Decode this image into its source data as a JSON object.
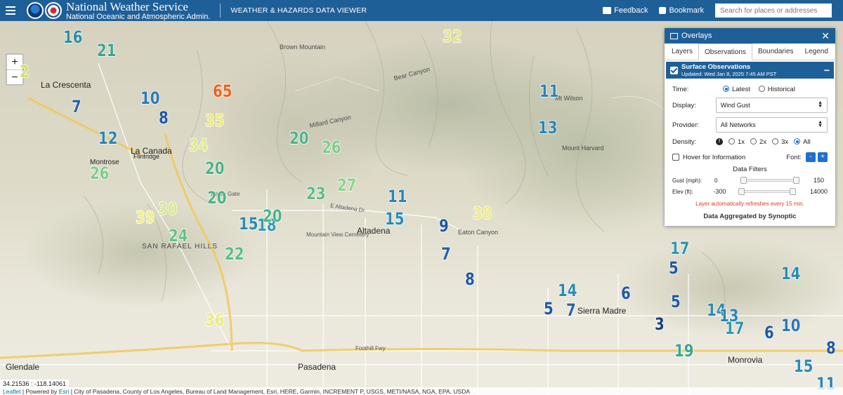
{
  "header": {
    "agency_name": "National Weather Service",
    "agency_sub": "National Oceanic and Atmospheric Admin.",
    "app_title": "WEATHER & HAZARDS DATA VIEWER",
    "feedback": "Feedback",
    "bookmark": "Bookmark",
    "search_placeholder": "Search for places or addresses"
  },
  "zoom": {
    "in": "+",
    "out": "−"
  },
  "panel": {
    "title": "Overlays",
    "close": "✕",
    "tabs": [
      "Layers",
      "Observations",
      "Boundaries",
      "Legend"
    ],
    "active_tab": "Observations",
    "section_title": "Surface Observations",
    "section_updated": "Updated: Wed Jan 8, 2025 7:45 AM PST",
    "collapse": "−",
    "time_label": "Time:",
    "time_options": [
      "Latest",
      "Historical"
    ],
    "time_selected": "Latest",
    "display_label": "Display:",
    "display_value": "Wind Gust",
    "provider_label": "Provider:",
    "provider_value": "All Networks",
    "density_label": "Density:",
    "density_options": [
      "1x",
      "2x",
      "3x",
      "All"
    ],
    "density_selected": "All",
    "hover_label": "Hover for Information",
    "font_label": "Font:",
    "font_minus": "-",
    "font_plus": "+",
    "filters_title": "Data Filters",
    "gust_label": "Gust (mph):",
    "gust_min": "0",
    "gust_max": "150",
    "elev_label": "Elev (ft):",
    "elev_min": "-300",
    "elev_max": "14000",
    "refresh_note": "Layer automatically refreshes every 15 min.",
    "aggregated": "Data Aggregated by Synoptic"
  },
  "map_labels": {
    "la_crescenta": "La Crescenta",
    "la_canada": "La Canada",
    "flintridge": "Flintridge",
    "montrose": "Montrose",
    "altadena": "Altadena",
    "pasadena": "Pasadena",
    "sierra_madre": "Sierra Madre",
    "monrovia": "Monrovia",
    "glendale": "Glendale",
    "mt_wilson": "Mt Wilson",
    "mount_harvard": "Mount Harvard",
    "san_rafael_hills": "SAN RAFAEL HILLS",
    "brown_mountain": "Brown Mountain",
    "bear_canyon": "Bear Canyon",
    "eaton_canyon": "Eaton Canyon",
    "millard_canyon": "Millard Canyon",
    "foothill_fwy": "Foothill Fwy",
    "e_altadena_dr": "E Altadena Dr",
    "mountain_view_cemetery": "Mountain View Cemetery",
    "devils_gate": "Devils Gate"
  },
  "observations": [
    {
      "value": "16",
      "color": "#2b8fa3"
    },
    {
      "value": "21",
      "color": "#3da58f"
    },
    {
      "value": "2",
      "color": "#d0e26c"
    },
    {
      "value": "10",
      "color": "#2a78b5"
    },
    {
      "value": "7",
      "color": "#2563a8"
    },
    {
      "value": "8",
      "color": "#1f5aa3"
    },
    {
      "value": "12",
      "color": "#2a85b5"
    },
    {
      "value": "65",
      "color": "#e8641f"
    },
    {
      "value": "35",
      "color": "#ecec7c"
    },
    {
      "value": "34",
      "color": "#dfe98a"
    },
    {
      "value": "20",
      "color": "#4cb38a"
    },
    {
      "value": "20",
      "color": "#4cb38a"
    },
    {
      "value": "26",
      "color": "#7fcd8a"
    },
    {
      "value": "20",
      "color": "#4cb38a"
    },
    {
      "value": "39",
      "color": "#f3ef8a"
    },
    {
      "value": "30",
      "color": "#d8ea8c"
    },
    {
      "value": "24",
      "color": "#67c187"
    },
    {
      "value": "22",
      "color": "#5bbd89"
    },
    {
      "value": "15",
      "color": "#2a8cb4"
    },
    {
      "value": "18",
      "color": "#319cb0"
    },
    {
      "value": "20",
      "color": "#4cb38a"
    },
    {
      "value": "23",
      "color": "#5bbd89"
    },
    {
      "value": "27",
      "color": "#8fd18a"
    },
    {
      "value": "20",
      "color": "#4cb38a"
    },
    {
      "value": "26",
      "color": "#7fcd8a"
    },
    {
      "value": "32",
      "color": "#e1e98a"
    },
    {
      "value": "11",
      "color": "#2a85b5"
    },
    {
      "value": "15",
      "color": "#2a8cb4"
    },
    {
      "value": "9",
      "color": "#1f5aa3"
    },
    {
      "value": "7",
      "color": "#2563a8"
    },
    {
      "value": "38",
      "color": "#f0eb86"
    },
    {
      "value": "8",
      "color": "#1f5aa3"
    },
    {
      "value": "11",
      "color": "#2a85b5"
    },
    {
      "value": "13",
      "color": "#2a85b5"
    },
    {
      "value": "36",
      "color": "#ecec80"
    },
    {
      "value": "14",
      "color": "#2a8cb4"
    },
    {
      "value": "5",
      "color": "#1f5aa3"
    },
    {
      "value": "7",
      "color": "#2563a8"
    },
    {
      "value": "6",
      "color": "#1f5aa3"
    },
    {
      "value": "3",
      "color": "#1a3f7a"
    },
    {
      "value": "5",
      "color": "#1f5aa3"
    },
    {
      "value": "5",
      "color": "#1f5aa3"
    },
    {
      "value": "17",
      "color": "#3197ad"
    },
    {
      "value": "14",
      "color": "#2a8cb4"
    },
    {
      "value": "13",
      "color": "#2a85b5"
    },
    {
      "value": "17",
      "color": "#3197ad"
    },
    {
      "value": "6",
      "color": "#1f5aa3"
    },
    {
      "value": "10",
      "color": "#2a78b5"
    },
    {
      "value": "14",
      "color": "#2a8cb4"
    },
    {
      "value": "19",
      "color": "#3da58f"
    },
    {
      "value": "15",
      "color": "#2a8cb4"
    },
    {
      "value": "8",
      "color": "#1f5aa3"
    },
    {
      "value": "11",
      "color": "#2a85b5"
    }
  ],
  "coords": "34.21536 : -118.14061",
  "attribution": {
    "leaflet": "Leaflet",
    "powered": " | Powered by ",
    "esri": "Esri",
    "text": " | City of Pasadena, County of Los Angeles, Bureau of Land Management, Esri, HERE, Garmin, INCREMENT P, USGS, METI/NASA, NGA, EPA, USDA"
  }
}
